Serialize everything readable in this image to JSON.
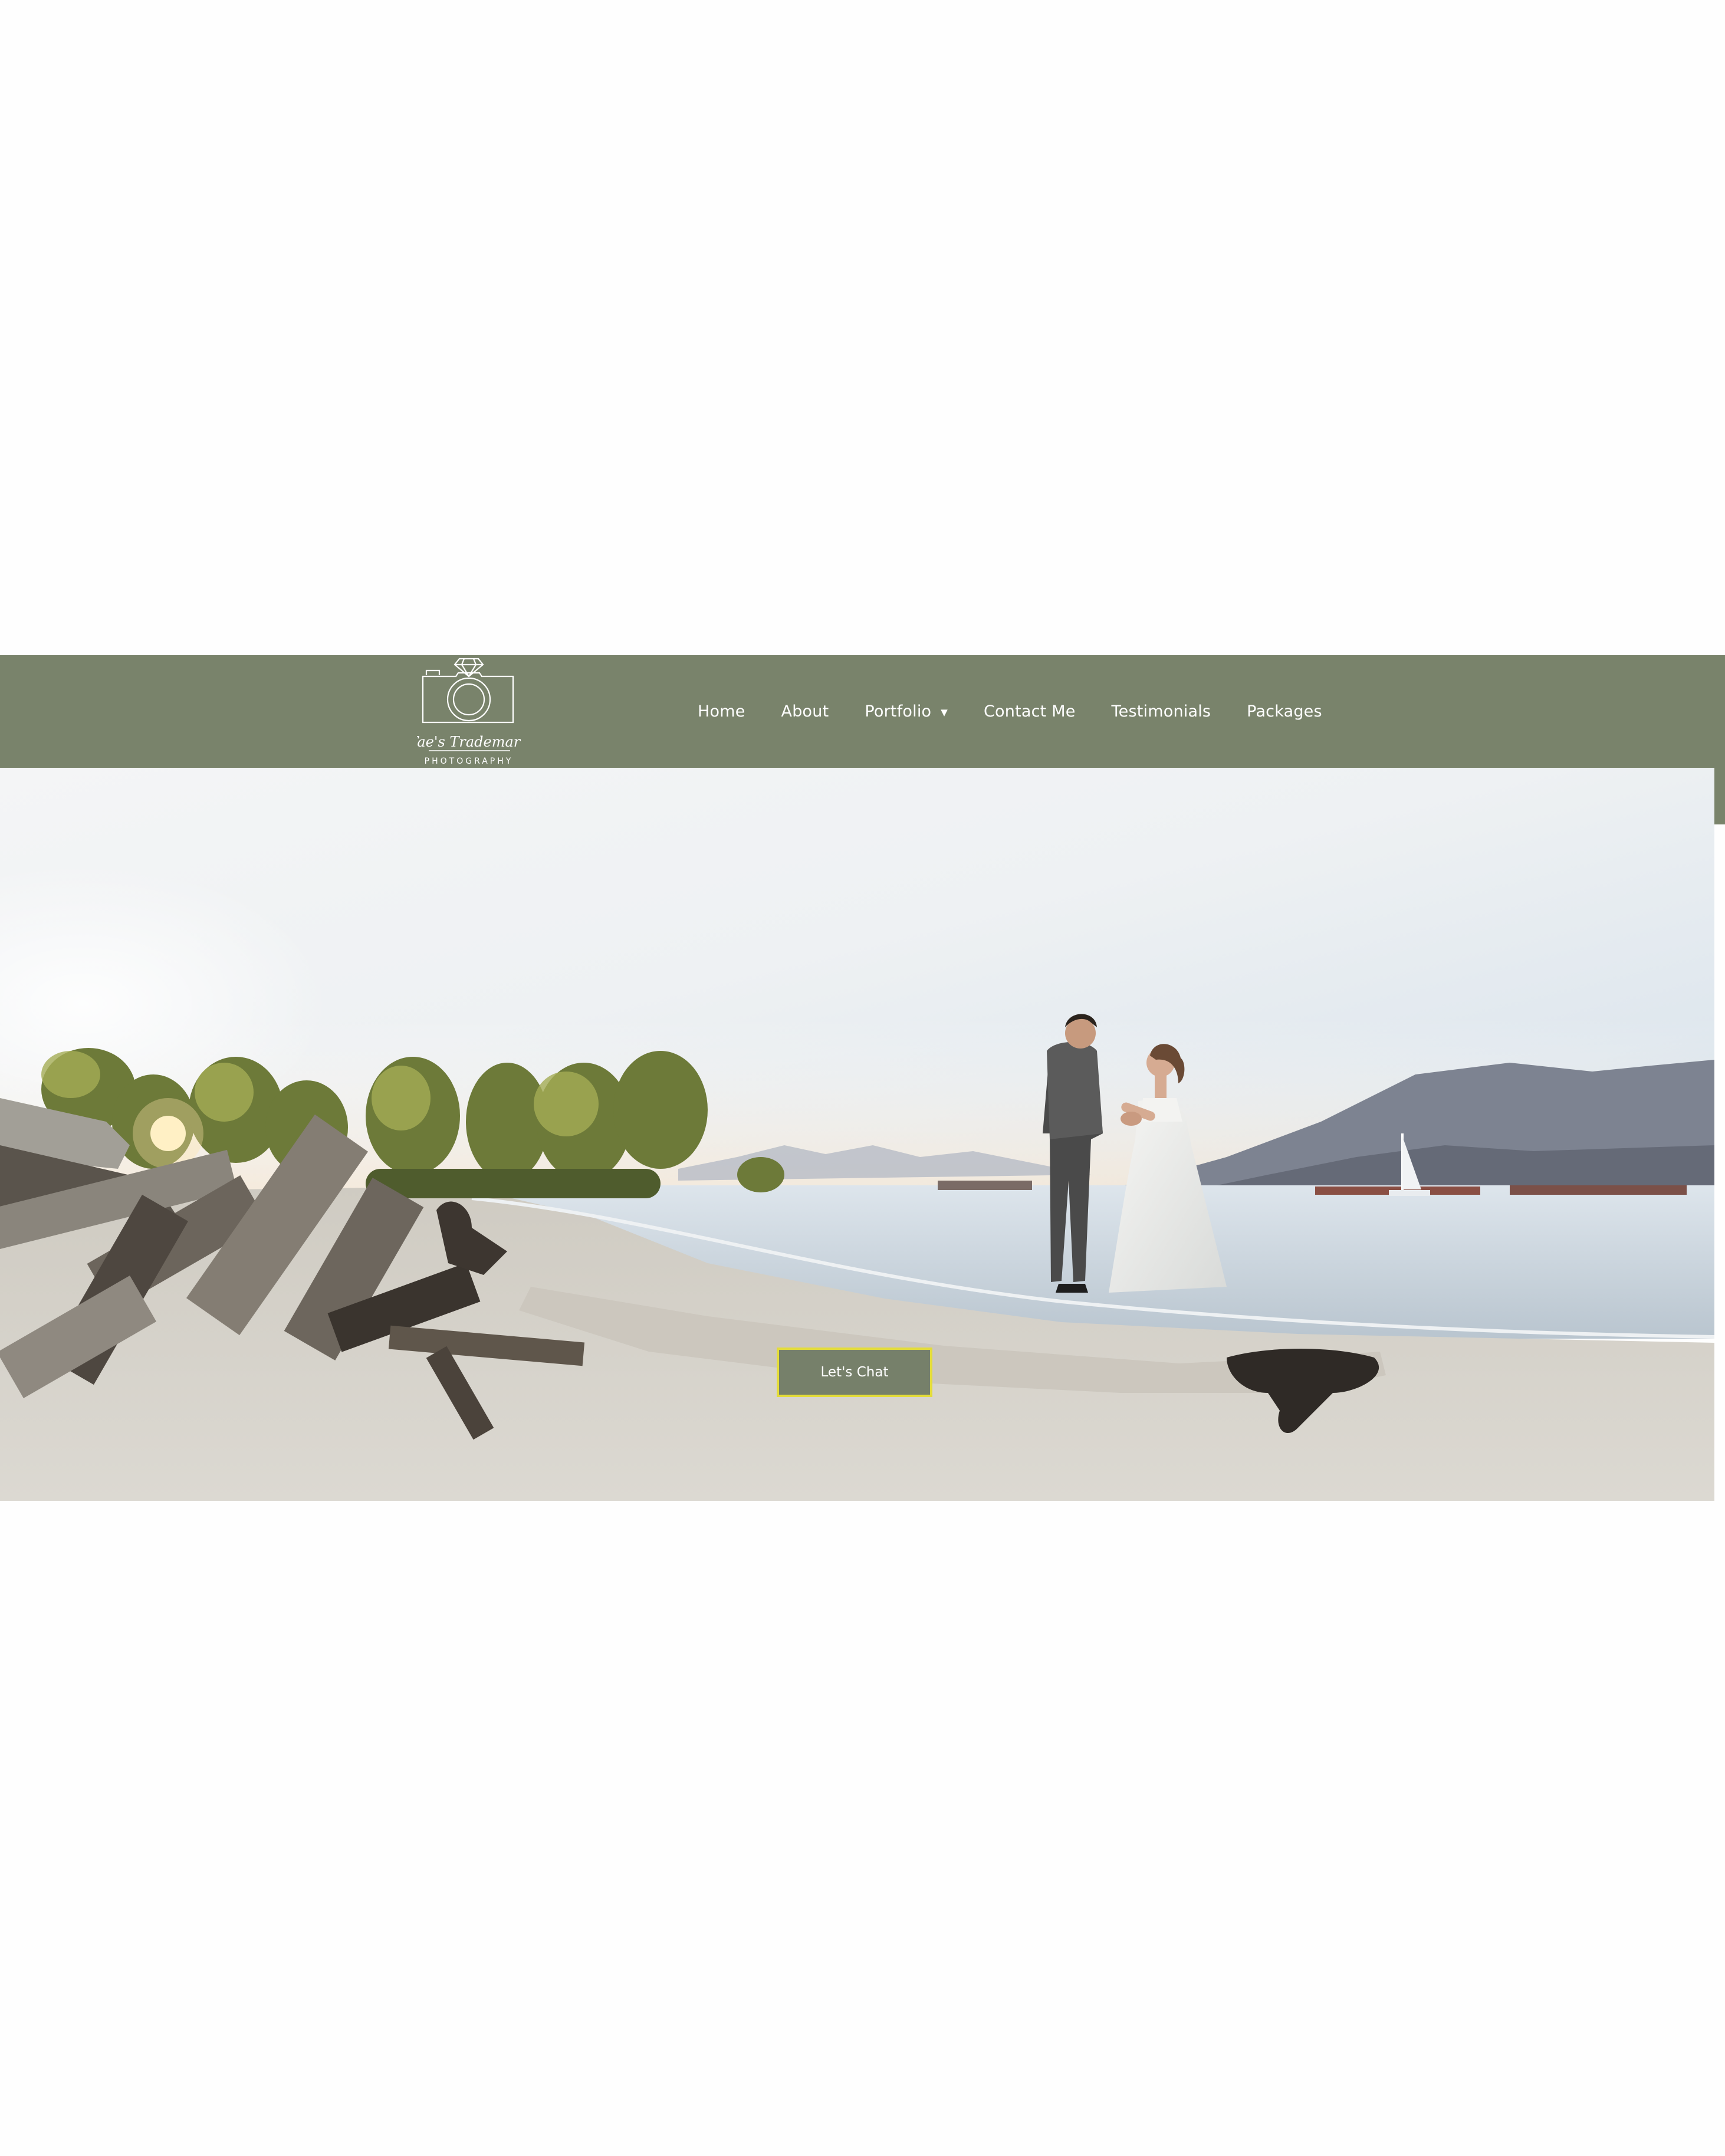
{
  "brand": {
    "logo_line1": "Tae's Trademark",
    "logo_line2": "PHOTOGRAPHY"
  },
  "nav": {
    "items": [
      {
        "label": "Home"
      },
      {
        "label": "About"
      },
      {
        "label": "Portfolio",
        "has_dropdown": true
      },
      {
        "label": "Contact Me"
      },
      {
        "label": "Testimonials"
      },
      {
        "label": "Packages"
      }
    ]
  },
  "hero": {
    "cta_label": "Let's Chat"
  },
  "colors": {
    "header": "#79836b",
    "cta_border": "#e3dc3a",
    "cta_bg": "#76806a"
  }
}
